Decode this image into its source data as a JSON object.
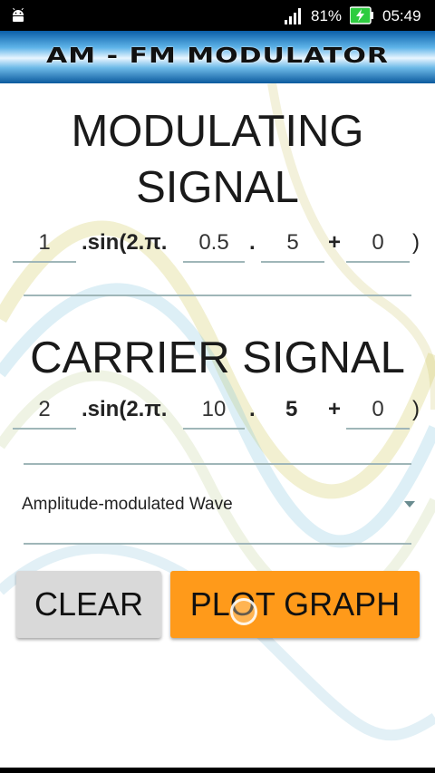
{
  "status_bar": {
    "battery_pct": "81%",
    "time": "05:49",
    "icons": [
      "android-icon",
      "signal-icon",
      "battery-charging-icon"
    ]
  },
  "banner": {
    "title": "AM - FM MODULATOR"
  },
  "modulating": {
    "heading_line1": "MODULATING",
    "heading_line2": "SIGNAL",
    "amplitude": "1",
    "sin_text": ".sin(2.π.",
    "frequency": "0.5",
    "dot_text": ".",
    "time": "5",
    "plus_text": "+",
    "phase": "0",
    "close_paren": ")"
  },
  "carrier": {
    "heading": "CARRIER SIGNAL",
    "amplitude": "2",
    "sin_text": ".sin(2.π.",
    "frequency": "10",
    "dot_text": ".",
    "time": "5",
    "plus_text": "+",
    "phase": "0",
    "close_paren": ")"
  },
  "dropdown": {
    "selected": "Amplitude-modulated Wave"
  },
  "buttons": {
    "clear_label": "CLEAR",
    "plot_label": "PLOT GRAPH"
  },
  "colors": {
    "plot_button": "#ff9a1a",
    "clear_button": "#d9d9d9",
    "underline": "#9fb6b8"
  }
}
